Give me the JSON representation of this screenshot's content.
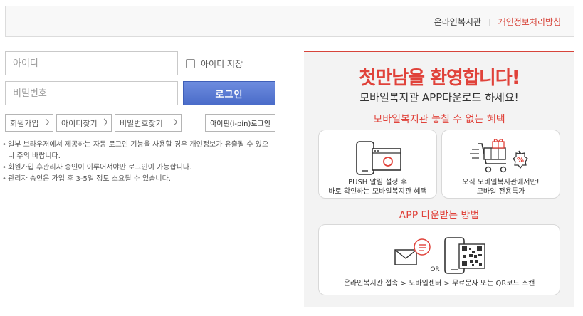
{
  "topbar": {
    "link_home": "온라인복지관",
    "link_privacy": "개인정보처리방침",
    "separator": "|"
  },
  "login": {
    "id_placeholder": "아이디",
    "pw_placeholder": "비밀번호",
    "save_id_label": "아이디 저장",
    "login_button": "로그인",
    "join_button": "회원가입",
    "find_id_button": "아이디찾기",
    "find_pw_button": "비밀번호찾기",
    "ipin_button": "아이핀(i-pin)로그인"
  },
  "notices": [
    "일부 브라우저에서 제공하는 자동 로그인 기능을 사용할 경우 개인정보가 유출될 수 있으니 주의 바랍니다.",
    "회원가입 후관리자 승인이 이루어져야만 로그인이 가능합니다.",
    "관리자 승인은 가입 후 3-5일 정도 소요될 수 있습니다."
  ],
  "promo": {
    "title": "첫만남을 환영합니다!",
    "subtitle": "모바일복지관 APP다운로드 하세요!",
    "benefit_title": "모바일복지관 놓칠 수 없는 혜택",
    "push_line1": "PUSH 알림 설정 후",
    "push_line2": "바로 확인하는 모바일복지관 혜택",
    "sale_line1": "오직 모바일복지관에서만!",
    "sale_line2": "모바일 전용특가",
    "method_title": "APP 다운받는 방법",
    "or_label": "OR",
    "percent_label": "%",
    "method_steps": "온라인복지관 접속 > 모바일센터 > 무료문자 또는 QR코드 스캔"
  },
  "colors": {
    "accent": "#e0423a",
    "login_button": "#5576d2"
  }
}
